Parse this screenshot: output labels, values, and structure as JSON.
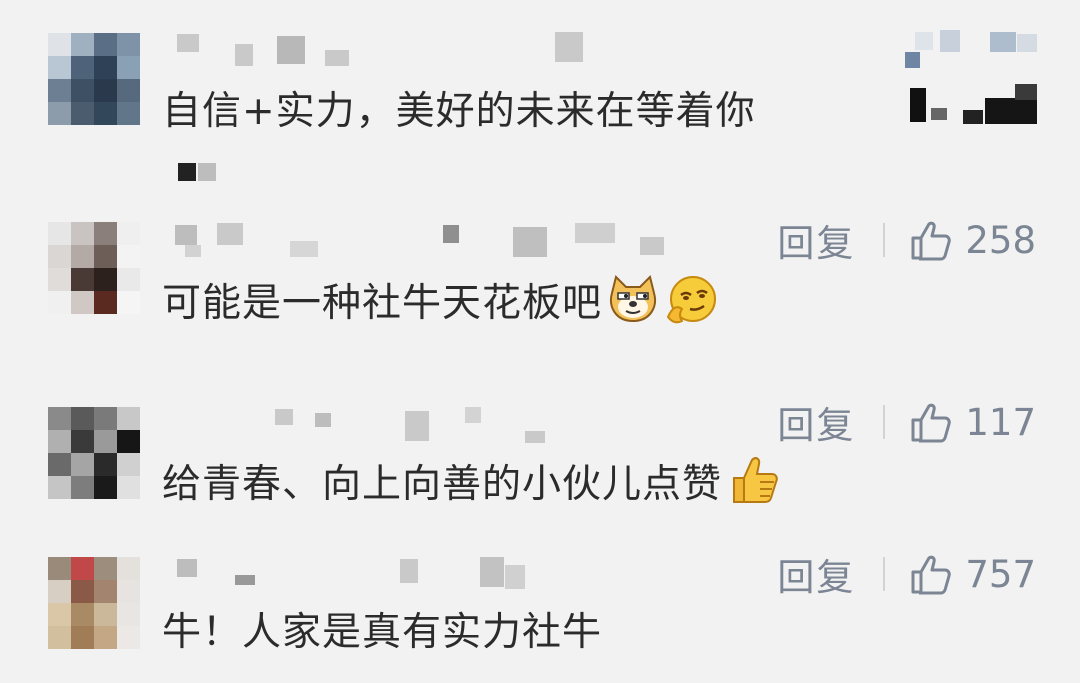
{
  "comments": [
    {
      "text": "自信+实力，美好的未来在等着你",
      "reply_label": "",
      "like_count": ""
    },
    {
      "text": "可能是一种社牛天花板吧",
      "reply_label": "回复",
      "like_count": "258",
      "emojis": [
        "doge-emoji",
        "smirk-emoji"
      ]
    },
    {
      "text": "给青春、向上向善的小伙儿点赞",
      "reply_label": "回复",
      "like_count": "117",
      "emojis": [
        "thumbs-up-emoji"
      ]
    },
    {
      "text": "牛！人家是真有实力社牛",
      "reply_label": "回复",
      "like_count": "757"
    }
  ],
  "colors": {
    "background": "#f2f2f2",
    "text": "#2b2b2b",
    "action": "#7b8593",
    "mosaic": "#c9c9c9"
  }
}
